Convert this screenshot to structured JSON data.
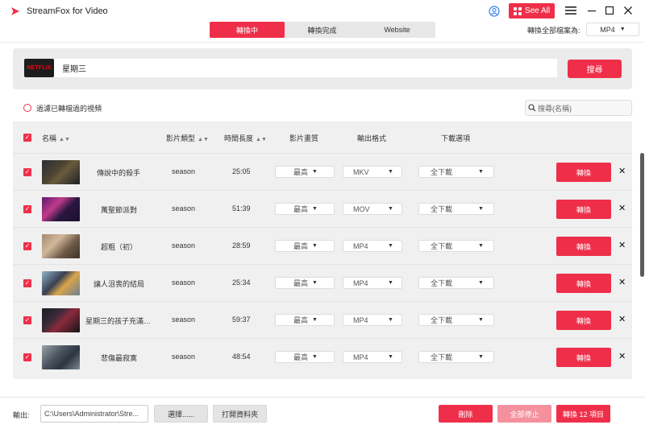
{
  "app": {
    "title": "StreamFox for Video",
    "see_all_label": "See All"
  },
  "tabs": [
    {
      "label": "轉換中",
      "active": true
    },
    {
      "label": "轉換完成",
      "active": false
    },
    {
      "label": "Website",
      "active": false
    }
  ],
  "convert_all": {
    "label": "轉換全部檔案為:",
    "format": "MP4"
  },
  "search": {
    "source_badge": "NETFLIX",
    "query": "星期三",
    "button_label": "搜尋"
  },
  "filter": {
    "label": "過濾已轉檔過的視頻",
    "list_search_placeholder": "搜尋(名稱)"
  },
  "table": {
    "headers": {
      "name": "名稱",
      "type": "影片類型",
      "duration": "時間長度",
      "quality": "影片畫質",
      "format": "輸出格式",
      "download": "下載選項"
    },
    "convert_label": "轉換",
    "rows": [
      {
        "title": "傳說中的殺手",
        "type": "season",
        "duration": "25:05",
        "quality": "最高",
        "format": "MKV",
        "download": "全下載"
      },
      {
        "title": "萬聖節派對",
        "type": "season",
        "duration": "51:39",
        "quality": "最高",
        "format": "MOV",
        "download": "全下載"
      },
      {
        "title": "超粗（初）",
        "type": "season",
        "duration": "28:59",
        "quality": "最高",
        "format": "MP4",
        "download": "全下載"
      },
      {
        "title": "讓人沮喪的結局",
        "type": "season",
        "duration": "25:34",
        "quality": "最高",
        "format": "MP4",
        "download": "全下載"
      },
      {
        "title": "星期三的孩子充滿…",
        "type": "season",
        "duration": "59:37",
        "quality": "最高",
        "format": "MP4",
        "download": "全下載"
      },
      {
        "title": "悲傷最寂寞",
        "type": "season",
        "duration": "48:54",
        "quality": "最高",
        "format": "MP4",
        "download": "全下載"
      }
    ]
  },
  "footer": {
    "output_label": "輸出:",
    "output_path": "C:\\Users\\Administrator\\Stre...",
    "choose_label": "選擇......",
    "open_folder_label": "打開資料夾",
    "delete_label": "刪除",
    "stop_all_label": "全部停止",
    "convert_count_label": "轉換 12 項目"
  },
  "colors": {
    "accent": "#ef2f4a",
    "accent_disabled": "#f5919e",
    "panel_bg": "#ebebeb"
  }
}
